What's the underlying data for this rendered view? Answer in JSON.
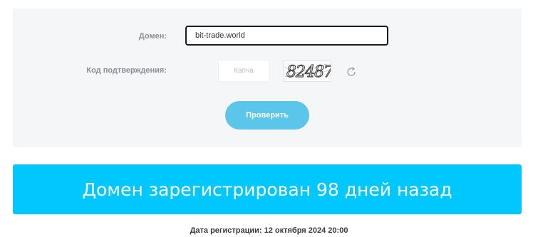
{
  "form": {
    "domain_label": "Домен:",
    "domain_value": "bit-trade.world",
    "code_label": "Код подтверждения:",
    "captcha_placeholder": "Капча",
    "captcha_image_text": "82487",
    "refresh_icon": "refresh-icon",
    "check_button_label": "Проверить"
  },
  "result": {
    "banner_text": "Домен зарегистрирован 98 дней назад",
    "registration_date": "Дата регистрации: 12 октября 2024 20:00"
  },
  "colors": {
    "panel_bg": "#f4f6f8",
    "button_bg": "#5bc5ea",
    "banner_bg": "#00c8ff"
  }
}
